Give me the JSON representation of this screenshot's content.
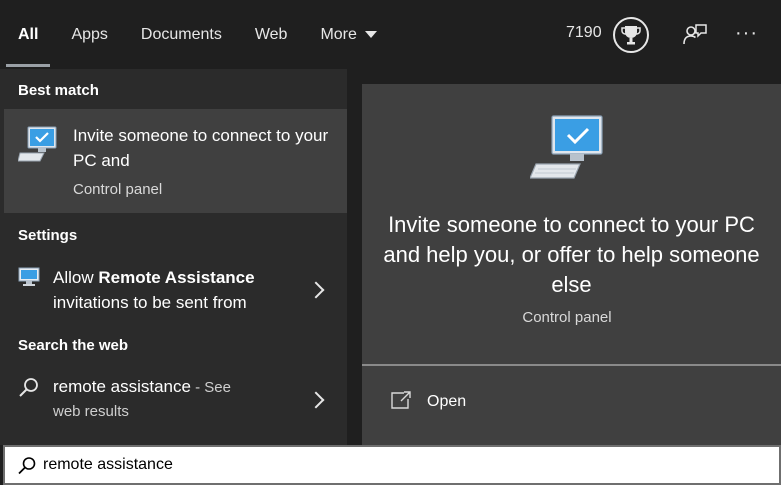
{
  "tabs": [
    {
      "label": "All",
      "active": true
    },
    {
      "label": "Apps"
    },
    {
      "label": "Documents"
    },
    {
      "label": "Web"
    },
    {
      "label": "More"
    }
  ],
  "points": "7190",
  "icons": {
    "trophy": "trophy-icon",
    "feedback": "feedback-icon",
    "more": "ellipsis-icon",
    "search": "search-icon",
    "open": "open-icon"
  },
  "left": {
    "best_match_header": "Best match",
    "best_match": {
      "title": "Invite someone to connect to your PC and",
      "subtitle": "Control panel"
    },
    "settings_header": "Settings",
    "setting_item": {
      "prefix": "Allow ",
      "bold": "Remote Assistance",
      "suffix": "invitations to be sent from"
    },
    "web_header": "Search the web",
    "web_item": {
      "query": "remote assistance",
      "see": " - See",
      "web_results": "web results"
    }
  },
  "right": {
    "title": "Invite someone to connect to your PC and help you, or offer to help someone else",
    "subtitle": "Control panel",
    "open_label": "Open"
  },
  "search": {
    "value": "remote assistance"
  },
  "colors": {
    "background": "#1f1f1f",
    "panel": "#2b2b2b",
    "selected": "#404040",
    "accent_icon": "#3a9ee4"
  }
}
